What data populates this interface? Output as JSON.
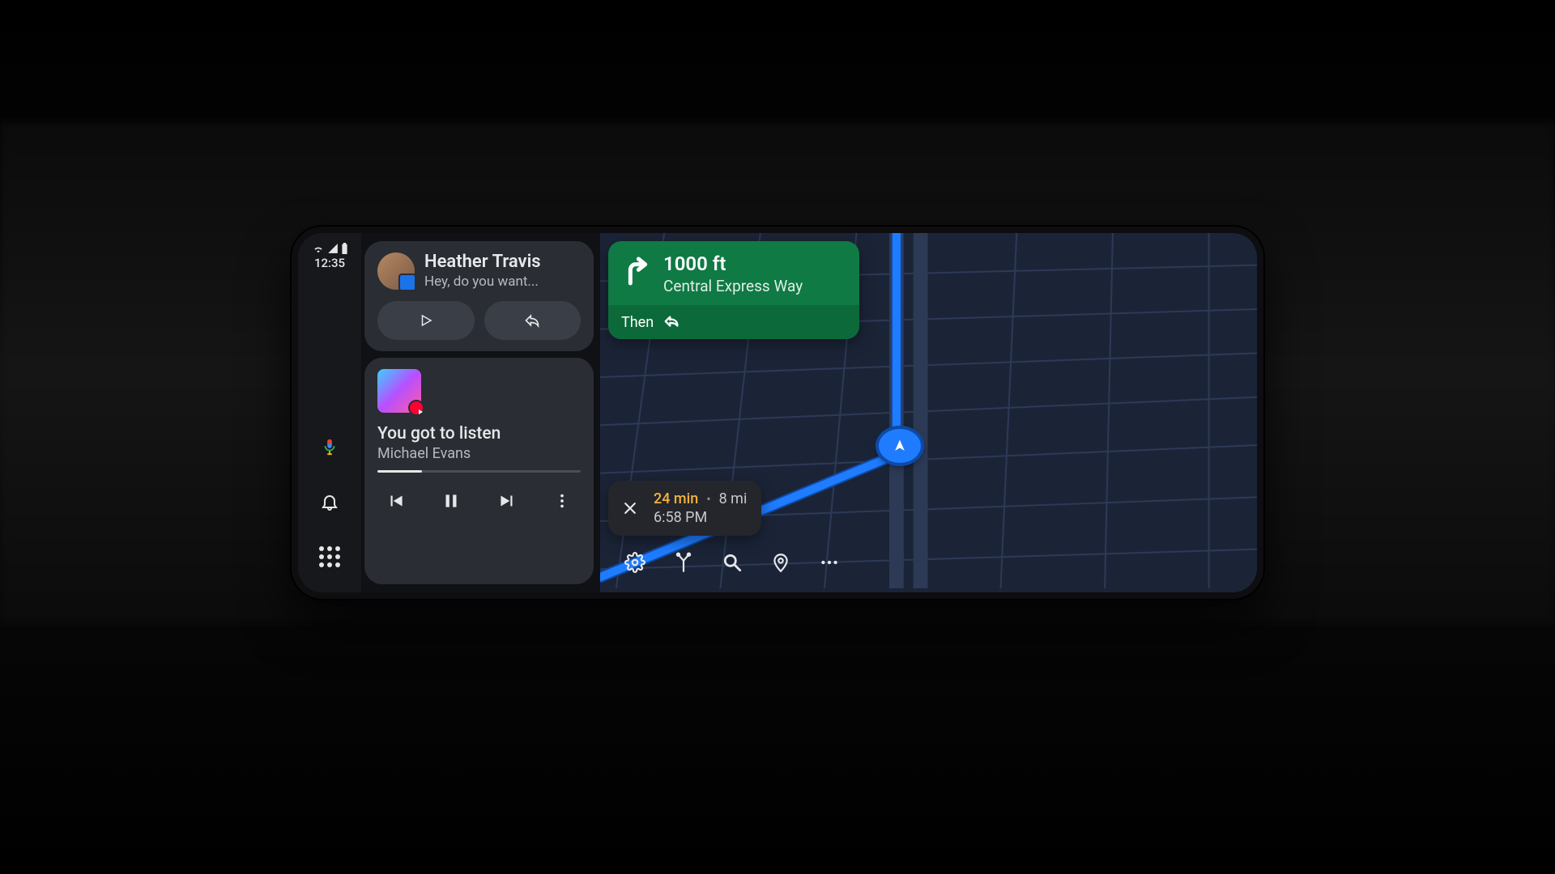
{
  "status": {
    "time": "12:35"
  },
  "message": {
    "sender": "Heather Travis",
    "preview": "Hey, do you want..."
  },
  "media": {
    "title": "You got to listen",
    "artist": "Michael Evans",
    "progress_pct": 22
  },
  "nav": {
    "distance": "1000 ft",
    "road": "Central Express Way",
    "then_label": "Then"
  },
  "eta": {
    "duration": "24 min",
    "distance": "8 mi",
    "arrival": "6:58 PM"
  }
}
